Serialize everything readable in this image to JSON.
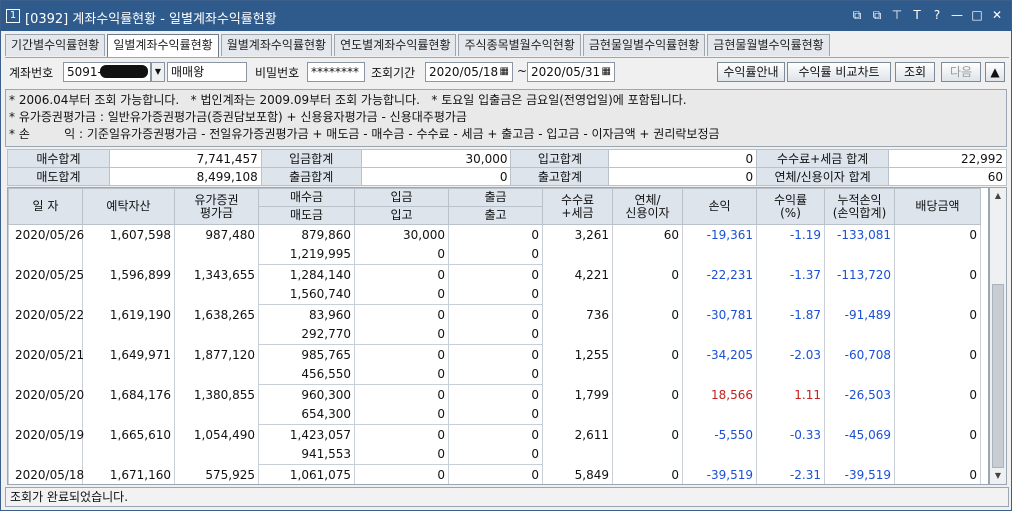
{
  "window": {
    "badge": "1",
    "title": "[0392] 계좌수익률현황 - 일별계좌수익률현황",
    "controls": [
      "⧉",
      "⧉",
      "⊤",
      "T",
      "?",
      "—",
      "□",
      "✕"
    ]
  },
  "tabs": [
    {
      "label": "기간별수익률현황",
      "active": false
    },
    {
      "label": "일별계좌수익률현황",
      "active": true
    },
    {
      "label": "월별계좌수익률현황",
      "active": false
    },
    {
      "label": "연도별계좌수익률현황",
      "active": false
    },
    {
      "label": "주식종목별월수익현황",
      "active": false
    },
    {
      "label": "금현물일별수익률현황",
      "active": false
    },
    {
      "label": "금현물월별수익률현황",
      "active": false
    }
  ],
  "toolbar": {
    "account_label": "계좌번호",
    "account_value": "5091-",
    "account_name": "매매왕",
    "password_label": "비밀번호",
    "password_value": "********",
    "period_label": "조회기간",
    "date_from": "2020/05/18",
    "date_to": "2020/05/31",
    "tilde": "~",
    "guide_button": "수익률안내",
    "compare_button": "수익률 비교차트",
    "query_button": "조회",
    "next_button": "다음"
  },
  "notes": [
    "* 2006.04부터 조회 가능합니다.   * 법인계좌는 2009.09부터 조회 가능합니다.   * 토요일 입출금은 금요일(전영업일)에 포함됩니다.",
    "* 유가증권평가금 : 일반유가증권평가금(증권담보포함) + 신용융자평가금 - 신용대주평가금",
    "* 손         익 : 기준일유가증권평가금 - 전일유가증권평가금 + 매도금 - 매수금 - 수수료 - 세금 + 출고금 - 입고금 - 이자금액 + 권리락보정금"
  ],
  "summary": {
    "row1": [
      {
        "label": "매수합계",
        "value": "7,741,457"
      },
      {
        "label": "입금합계",
        "value": "30,000"
      },
      {
        "label": "입고합계",
        "value": "0"
      },
      {
        "label": "수수료+세금 합계",
        "value": "22,992"
      }
    ],
    "row2": [
      {
        "label": "매도합계",
        "value": "8,499,108"
      },
      {
        "label": "출금합계",
        "value": "0"
      },
      {
        "label": "출고합계",
        "value": "0"
      },
      {
        "label": "연체/신용이자 합계",
        "value": "60"
      }
    ]
  },
  "grid": {
    "headers": {
      "date": "일 자",
      "deposit_asset": "예탁자산",
      "securities_eval": "유가증권\n평가금",
      "buy": "매수금",
      "sell": "매도금",
      "deposit_in": "입금",
      "stock_in": "입고",
      "withdraw": "출금",
      "stock_out": "출고",
      "fee_tax": "수수료\n+세금",
      "interest": "연체/\n신용이자",
      "profit": "손익",
      "return_pct": "수익률\n(%)",
      "cum_profit": "누적손익\n(손익합계)",
      "dividend": "배당금액"
    },
    "rows": [
      {
        "date": "2020/05/26",
        "asset": "1,607,598",
        "eval": "987,480",
        "buy": "879,860",
        "sell": "1,219,995",
        "dep": "30,000",
        "sin": "0",
        "wd": "0",
        "sout": "0",
        "fee": "3,261",
        "interest": "60",
        "profit": "-19,361",
        "ret": "-1.19",
        "cum": "-133,081",
        "div": "0",
        "sign": "neg"
      },
      {
        "date": "2020/05/25",
        "asset": "1,596,899",
        "eval": "1,343,655",
        "buy": "1,284,140",
        "sell": "1,560,740",
        "dep": "0",
        "sin": "0",
        "wd": "0",
        "sout": "0",
        "fee": "4,221",
        "interest": "0",
        "profit": "-22,231",
        "ret": "-1.37",
        "cum": "-113,720",
        "div": "0",
        "sign": "neg"
      },
      {
        "date": "2020/05/22",
        "asset": "1,619,190",
        "eval": "1,638,265",
        "buy": "83,960",
        "sell": "292,770",
        "dep": "0",
        "sin": "0",
        "wd": "0",
        "sout": "0",
        "fee": "736",
        "interest": "0",
        "profit": "-30,781",
        "ret": "-1.87",
        "cum": "-91,489",
        "div": "0",
        "sign": "neg"
      },
      {
        "date": "2020/05/21",
        "asset": "1,649,971",
        "eval": "1,877,120",
        "buy": "985,765",
        "sell": "456,550",
        "dep": "0",
        "sin": "0",
        "wd": "0",
        "sout": "0",
        "fee": "1,255",
        "interest": "0",
        "profit": "-34,205",
        "ret": "-2.03",
        "cum": "-60,708",
        "div": "0",
        "sign": "neg"
      },
      {
        "date": "2020/05/20",
        "asset": "1,684,176",
        "eval": "1,380,855",
        "buy": "960,300",
        "sell": "654,300",
        "dep": "0",
        "sin": "0",
        "wd": "0",
        "sout": "0",
        "fee": "1,799",
        "interest": "0",
        "profit": "18,566",
        "ret": "1.11",
        "cum": "-26,503",
        "div": "0",
        "sign": "pos"
      },
      {
        "date": "2020/05/19",
        "asset": "1,665,610",
        "eval": "1,054,490",
        "buy": "1,423,057",
        "sell": "941,553",
        "dep": "0",
        "sin": "0",
        "wd": "0",
        "sout": "0",
        "fee": "2,611",
        "interest": "0",
        "profit": "-5,550",
        "ret": "-0.33",
        "cum": "-45,069",
        "div": "0",
        "sign": "neg"
      },
      {
        "date": "2020/05/18",
        "asset": "1,671,160",
        "eval": "575,925",
        "buy": "1,061,075",
        "sell": "",
        "dep": "0",
        "sin": "",
        "wd": "0",
        "sout": "",
        "fee": "5,849",
        "interest": "0",
        "profit": "-39,519",
        "ret": "-2.31",
        "cum": "-39,519",
        "div": "0",
        "sign": "neg"
      }
    ]
  },
  "status_text": "조회가 완료되었습니다.",
  "colors": {
    "title_bar": "#2f5a8c",
    "negative": "#1a4fd6",
    "positive": "#c42020",
    "header_bg": "#dde4ec"
  }
}
